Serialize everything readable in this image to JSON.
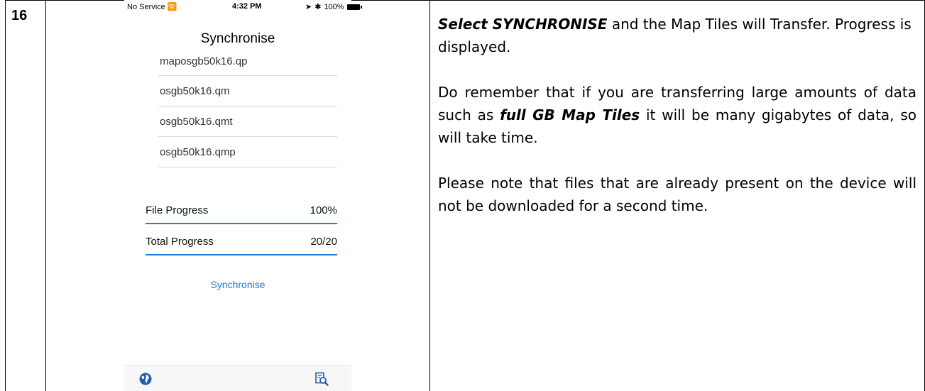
{
  "step": {
    "number": "16"
  },
  "phone": {
    "status_bar": {
      "carrier": "No Service",
      "time": "4:32 PM",
      "battery": "100%"
    },
    "title": "Synchronise",
    "files": [
      "maposgb50k16.qp",
      "osgb50k16.qm",
      "osgb50k16.qmt",
      "osgb50k16.qmp"
    ],
    "file_progress": {
      "label": "File Progress",
      "value": "100%",
      "fraction": 1.0
    },
    "total_progress": {
      "label": "Total Progress",
      "value": "20/20",
      "fraction": 1.0
    },
    "sync_button_label": "Synchronise",
    "tabs": {
      "left_icon": "globe-icon",
      "right_icon": "document-search-icon"
    }
  },
  "instructions": {
    "p1_emph": "Select SYNCHRONISE",
    "p1_rest": " and the Map Tiles will Transfer. Progress is displayed.",
    "p2_start": "Do remember that if you are transferring large amounts of data such as ",
    "p2_emph": "full GB Map Tiles",
    "p2_end": " it will be many gigabytes of data, so will take time.",
    "p3": "Please note that files that are already present on the device will not be downloaded for a second time."
  },
  "colors": {
    "accent": "#1a7ce0",
    "globe": "#1f5fae"
  }
}
